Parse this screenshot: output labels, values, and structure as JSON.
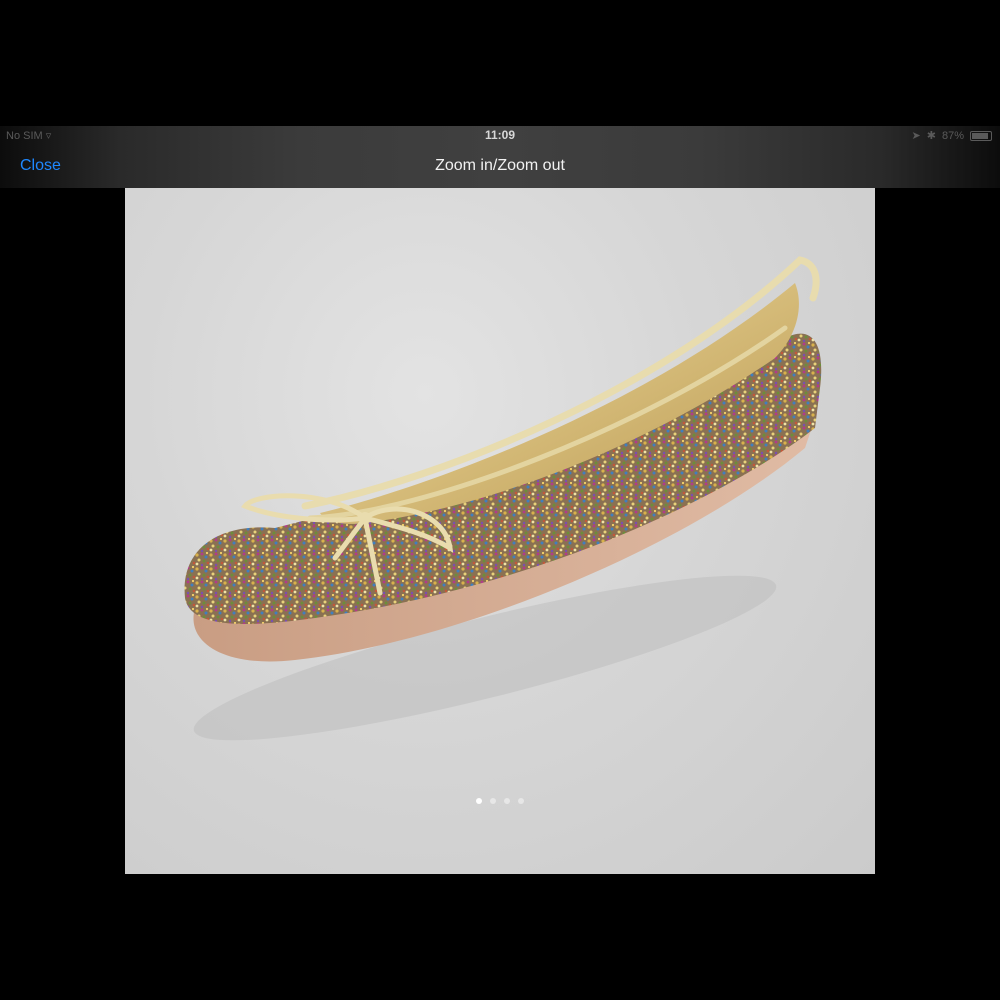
{
  "status_bar": {
    "carrier": "No SIM",
    "time": "11:09",
    "battery": "87%",
    "battery_level": 0.87
  },
  "nav": {
    "close_label": "Close",
    "title": "Zoom in/Zoom out"
  },
  "gallery": {
    "page_count": 4,
    "current_page": 1
  },
  "colors": {
    "link": "#1e88ff",
    "background": "#000000"
  }
}
